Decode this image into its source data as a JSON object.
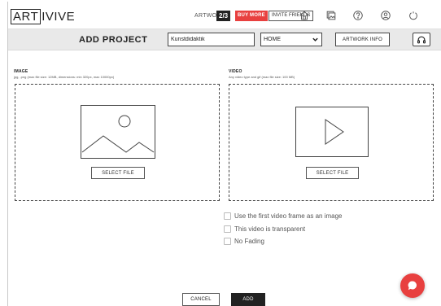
{
  "header": {
    "logo_boxed": "ART",
    "logo_rest": "IVIVE",
    "artworks_label": "ARTWORKS",
    "artworks_count": "2/3",
    "buy_more": "BUY MORE",
    "invite_friends": "INVITE FRIENDS",
    "icons": [
      "home-icon",
      "gallery-icon",
      "help-icon",
      "account-icon",
      "power-icon"
    ]
  },
  "titlebar": {
    "title": "ADD PROJECT",
    "name_value": "Kunstdidaktik",
    "category_selected": "HOME",
    "artwork_info": "ARTWORK INFO"
  },
  "image_section": {
    "title": "IMAGE",
    "subtitle": "jpg, .png (max file size: 12MB, dimensions: min 320px, max 10000px)",
    "select_file": "SELECT FILE"
  },
  "video_section": {
    "title": "VIDEO",
    "subtitle": "Any video type and gif (max file size: 100 MB)",
    "select_file": "SELECT FILE"
  },
  "options": [
    {
      "label": "Use the first video frame as an image",
      "checked": false
    },
    {
      "label": "This video is transparent",
      "checked": false
    },
    {
      "label": "No Fading",
      "checked": false
    }
  ],
  "footer": {
    "cancel": "CANCEL",
    "add": "ADD"
  },
  "colors": {
    "accent_red": "#e8403f",
    "dark": "#222222",
    "titlebar_bg": "#e9e9e9"
  }
}
